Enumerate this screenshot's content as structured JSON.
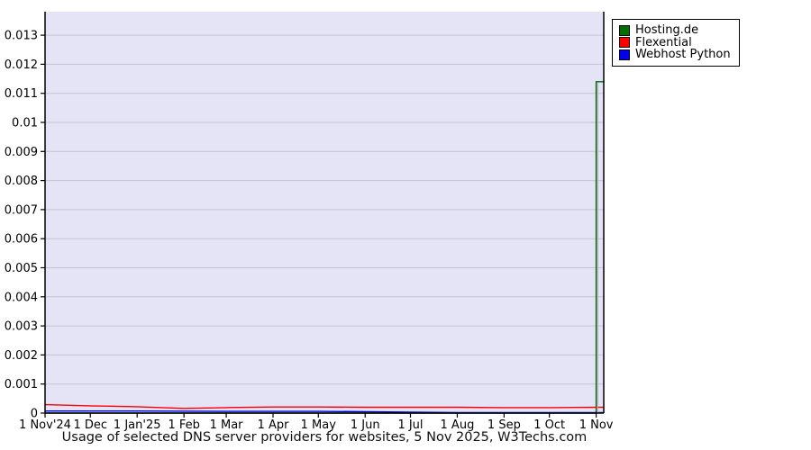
{
  "chart_data": {
    "type": "line",
    "title": "Usage of selected DNS server providers for websites, 5 Nov 2025, W3Techs.com",
    "xlabel": "",
    "ylabel": "",
    "ylim": [
      0,
      0.0138
    ],
    "grid": "horizontal",
    "plot_bg_color": "#e4e4f6",
    "grid_color": "#c4c4cc",
    "axis_color": "#000000",
    "date_marker": {
      "day": 366,
      "color": "#b0b0b8",
      "note": "vertical gray line at 1 Nov 2025"
    },
    "y_tick_values": [
      0,
      0.001,
      0.002,
      0.003,
      0.004,
      0.005,
      0.006,
      0.007,
      0.008,
      0.009,
      0.01,
      0.011,
      0.012,
      0.013
    ],
    "y_tick_labels": [
      "0",
      "0.001",
      "0.002",
      "0.003",
      "0.004",
      "0.005",
      "0.006",
      "0.007",
      "0.008",
      "0.009",
      "0.01",
      "0.011",
      "0.012",
      "0.013"
    ],
    "x_ticks": [
      {
        "day": 0,
        "label": "1 Nov'24"
      },
      {
        "day": 30,
        "label": "1 Dec"
      },
      {
        "day": 61,
        "label": "1 Jan'25"
      },
      {
        "day": 92,
        "label": "1 Feb"
      },
      {
        "day": 120,
        "label": "1 Mar"
      },
      {
        "day": 151,
        "label": "1 Apr"
      },
      {
        "day": 181,
        "label": "1 May"
      },
      {
        "day": 212,
        "label": "1 Jun"
      },
      {
        "day": 242,
        "label": "1 Jul"
      },
      {
        "day": 273,
        "label": "1 Aug"
      },
      {
        "day": 304,
        "label": "1 Sep"
      },
      {
        "day": 334,
        "label": "1 Oct"
      },
      {
        "day": 365,
        "label": "1 Nov"
      }
    ],
    "legend": {
      "position": "top-right",
      "entries": [
        {
          "label": "Hosting.de",
          "color": "#007000"
        },
        {
          "label": "Flexential",
          "color": "#ff0000"
        },
        {
          "label": "Webhost Python",
          "color": "#0000ee"
        }
      ]
    },
    "series": [
      {
        "name": "Hosting.de",
        "color": "#006400",
        "points": [
          [
            0,
            0
          ],
          [
            365,
            0
          ],
          [
            365,
            0.0114
          ],
          [
            370,
            0.0114
          ]
        ]
      },
      {
        "name": "Flexential",
        "color": "#ff0000",
        "points": [
          [
            0,
            0.00029
          ],
          [
            30,
            0.00025
          ],
          [
            61,
            0.00022
          ],
          [
            92,
            0.00016
          ],
          [
            120,
            0.00019
          ],
          [
            151,
            0.00021
          ],
          [
            181,
            0.00021
          ],
          [
            212,
            0.0002
          ],
          [
            242,
            0.0002
          ],
          [
            273,
            0.0002
          ],
          [
            304,
            0.00019
          ],
          [
            334,
            0.00019
          ],
          [
            370,
            0.0002
          ]
        ]
      },
      {
        "name": "Webhost Python",
        "color": "#0000e6",
        "points": [
          [
            0,
            7e-05
          ],
          [
            61,
            7e-05
          ],
          [
            120,
            6e-05
          ],
          [
            181,
            6e-05
          ],
          [
            212,
            5e-05
          ],
          [
            242,
            3e-05
          ],
          [
            273,
            2e-05
          ],
          [
            334,
            2e-05
          ],
          [
            370,
            2e-05
          ]
        ]
      }
    ]
  },
  "footer": {
    "title": "Usage of selected DNS server providers for websites, 5 Nov 2025, W3Techs.com"
  }
}
